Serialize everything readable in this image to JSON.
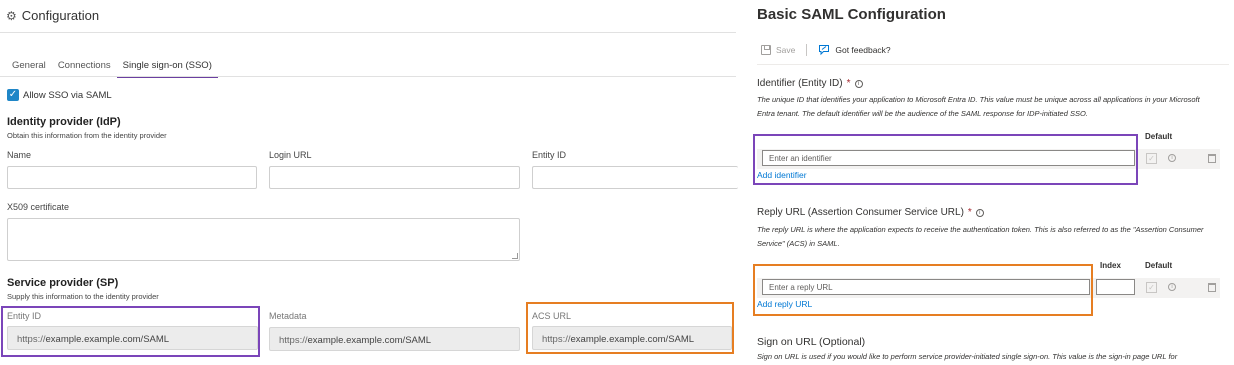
{
  "left": {
    "title": "Configuration",
    "tabs": [
      "General",
      "Connections",
      "Single sign-on (SSO)"
    ],
    "active_tab": 2,
    "allow_sso_label": "Allow SSO via SAML",
    "allow_sso_checked": true,
    "idp": {
      "title": "Identity provider (IdP)",
      "subtitle": "Obtain this information from the identity provider",
      "name_label": "Name",
      "login_url_label": "Login URL",
      "entity_id_label": "Entity ID",
      "x509_label": "X509 certificate"
    },
    "sp": {
      "title": "Service provider (SP)",
      "subtitle": "Supply this information to the identity provider",
      "entity_id_label": "Entity ID",
      "entity_id_prefix": "https://",
      "entity_id_value": "example.example.com/SAML",
      "metadata_label": "Metadata",
      "metadata_prefix": "https://",
      "metadata_value": "example.example.com/SAML",
      "acs_label": "ACS URL",
      "acs_prefix": "https://",
      "acs_value": "example.example.com/SAML"
    },
    "accent_colors": {
      "purple": "#7b45b9",
      "orange": "#e67e22",
      "checkbox": "#1f86c7"
    }
  },
  "right": {
    "title": "Basic SAML Configuration",
    "toolbar": {
      "save_label": "Save",
      "feedback_label": "Got feedback?"
    },
    "identifier": {
      "heading": "Identifier (Entity ID)",
      "required_mark": "*",
      "info_glyph": "i",
      "description": "The unique ID that identifies your application to Microsoft Entra ID. This value must be unique across all applications in your Microsoft Entra tenant. The default identifier will be the audience of the SAML response for IDP-initiated SSO.",
      "default_header": "Default",
      "placeholder": "Enter an identifier",
      "add_link": "Add identifier"
    },
    "reply_url": {
      "heading": "Reply URL (Assertion Consumer Service URL)",
      "required_mark": "*",
      "info_glyph": "i",
      "description": "The reply URL is where the application expects to receive the authentication token. This is also referred to as the \"Assertion Consumer Service\" (ACS) in SAML.",
      "index_header": "Index",
      "default_header": "Default",
      "placeholder": "Enter a reply URL",
      "add_link": "Add reply URL"
    },
    "sign_on": {
      "heading": "Sign on URL (Optional)",
      "description": "Sign on URL is used if you would like to perform service provider-initiated single sign-on. This value is the sign-in page URL for"
    }
  }
}
